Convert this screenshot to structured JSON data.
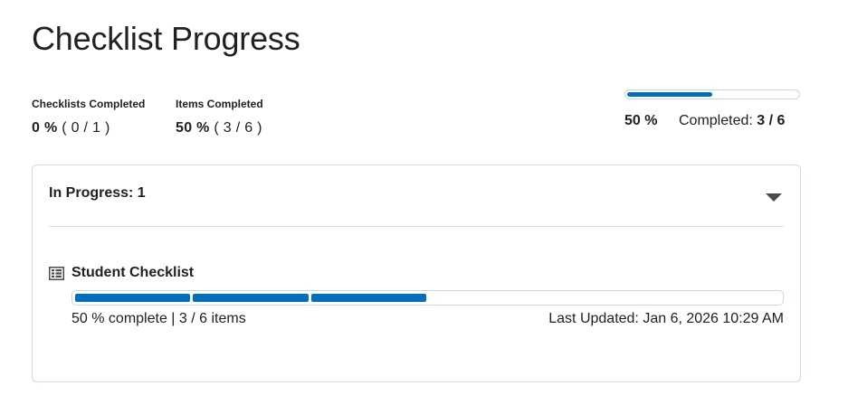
{
  "page": {
    "title": "Checklist Progress"
  },
  "summary": {
    "checklists": {
      "label": "Checklists Completed",
      "percent": "0 %",
      "fraction": "( 0 / 1 )"
    },
    "items": {
      "label": "Items Completed",
      "percent": "50 %",
      "fraction": "( 3 / 6 )"
    }
  },
  "overall": {
    "progress": 0.5,
    "percent": "50 %",
    "completed_label": "Completed:",
    "completed_value": "3 / 6"
  },
  "in_progress_panel": {
    "heading": "In Progress: 1",
    "expanded": true,
    "checklists": [
      {
        "name": "Student Checklist",
        "icon": "checklist-icon",
        "segments_total": 6,
        "segments_completed": 3,
        "progress_text": "50 % complete | 3 / 6 items",
        "last_updated": "Last Updated: Jan 6, 2026 10:29 AM"
      }
    ]
  },
  "colors": {
    "accent": "#006fbf",
    "text": "#202122",
    "border": "#cdd5dc",
    "caret": "#494c4e"
  }
}
